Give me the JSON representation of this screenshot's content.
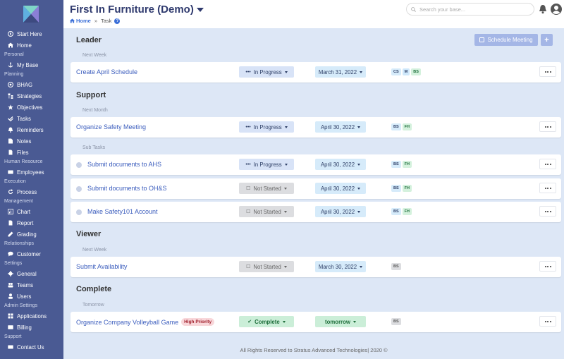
{
  "app": {
    "title": "First In Furniture (Demo)",
    "breadcrumb": {
      "home": "Home",
      "separator": "»",
      "current": "Task",
      "help": "?"
    },
    "search_placeholder": "Search your base..."
  },
  "sidebar": {
    "start_here": "Start Here",
    "home": "Home",
    "personal": "Personal",
    "my_base": "My Base",
    "planning": "Planning",
    "bhag": "BHAG",
    "strategies": "Strategies",
    "objectives": "Objectives",
    "tasks": "Tasks",
    "reminders": "Reminders",
    "notes": "Notes",
    "files": "Files",
    "human_resource": "Human Resource",
    "employees": "Employees",
    "execution": "Execution",
    "process": "Process",
    "management": "Management",
    "chart": "Chart",
    "report": "Report",
    "grading": "Grading",
    "relationships": "Relationships",
    "customer": "Customer",
    "settings": "Settings",
    "general": "General",
    "teams": "Teams",
    "users": "Users",
    "admin_settings": "Admin Settings",
    "applications": "Applications",
    "billing": "Billing",
    "support": "Support",
    "contact_us": "Contact Us"
  },
  "toolbar": {
    "schedule_meeting": "Schedule Meeting",
    "add": "+"
  },
  "groups": {
    "leader": "Leader",
    "support": "Support",
    "viewer": "Viewer",
    "complete": "Complete"
  },
  "subheads": {
    "leader_when": "Next Week",
    "support_when": "Next Month",
    "support_sub": "Sub Tasks",
    "viewer_when": "Next Week",
    "complete_when": "Tomorrow"
  },
  "tasks": {
    "t1": {
      "name": "Create April Schedule",
      "status": "In Progress",
      "date": "March 31, 2022",
      "badges": [
        "CS",
        "M",
        "BS"
      ]
    },
    "t2": {
      "name": "Organize Safety Meeting",
      "status": "In Progress",
      "date": "April 30, 2022",
      "badges": [
        "BS",
        "FH"
      ]
    },
    "t3": {
      "name": "Submit documents to AHS",
      "status": "In Progress",
      "date": "April 30, 2022",
      "badges": [
        "BS",
        "FH"
      ]
    },
    "t4": {
      "name": "Submit documents to OH&S",
      "status": "Not Started",
      "date": "April 30, 2022",
      "badges": [
        "BS",
        "FH"
      ]
    },
    "t5": {
      "name": "Make Safety101 Account",
      "status": "Not Started",
      "date": "April 30, 2022",
      "badges": [
        "BS",
        "FH"
      ]
    },
    "t6": {
      "name": "Submit Availability",
      "status": "Not Started",
      "date": "March 30, 2022",
      "badges": [
        "BS"
      ]
    },
    "t7": {
      "name": "Organize Company Volleyball Game",
      "priority": "High Priority",
      "status": "Complete",
      "date": "tomorrow",
      "badges": [
        "BS"
      ]
    }
  },
  "footer": "All Rights Reserved to Stratus Advanced Technologies| 2020 ©"
}
